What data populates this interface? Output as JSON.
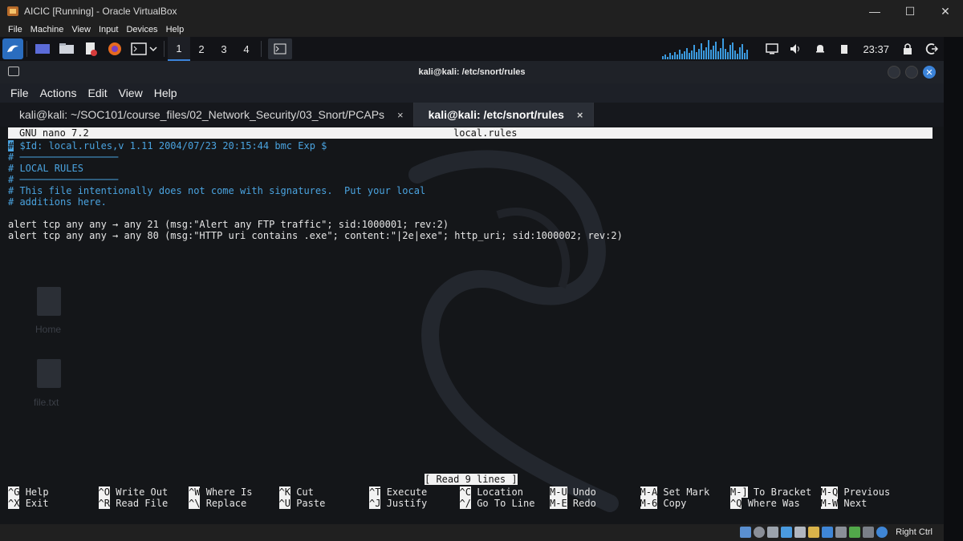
{
  "vbox": {
    "title": "AICIC [Running] - Oracle VirtualBox",
    "menu": [
      "File",
      "Machine",
      "View",
      "Input",
      "Devices",
      "Help"
    ],
    "window_controls": {
      "minimize": "—",
      "maximize": "☐",
      "close": "✕"
    },
    "host_key": "Right Ctrl"
  },
  "panel": {
    "workspaces": [
      "1",
      "2",
      "3",
      "4"
    ],
    "active_workspace": "1",
    "clock": "23:37"
  },
  "terminal": {
    "title": "kali@kali: /etc/snort/rules",
    "menu": [
      "File",
      "Actions",
      "Edit",
      "View",
      "Help"
    ],
    "tabs": [
      {
        "label": "kali@kali: ~/SOC101/course_files/02_Network_Security/03_Snort/PCAPs",
        "close": "×"
      },
      {
        "label": "kali@kali: /etc/snort/rules",
        "close": "×"
      }
    ],
    "close_glyph": "✕"
  },
  "nano": {
    "version": "GNU nano 7.2",
    "filename": "local.rules",
    "cursor_char": "#",
    "lines": [
      " $Id: local.rules,v 1.11 2004/07/23 20:15:44 bmc Exp $",
      "# ─────────────────",
      "# LOCAL RULES",
      "# ─────────────────",
      "# This file intentionally does not come with signatures.  Put your local",
      "# additions here.",
      "",
      "alert tcp any any → any 21 (msg:\"Alert any FTP traffic\"; sid:1000001; rev:2)",
      "alert tcp any any → any 80 (msg:\"HTTP uri contains .exe\"; content:\"|2e|exe\"; http_uri; sid:1000002; rev:2)"
    ],
    "status": "[ Read 9 lines ]",
    "shortcuts": [
      {
        "key": "^G",
        "label": "Help"
      },
      {
        "key": "^O",
        "label": "Write Out"
      },
      {
        "key": "^W",
        "label": "Where Is"
      },
      {
        "key": "^K",
        "label": "Cut"
      },
      {
        "key": "^T",
        "label": "Execute"
      },
      {
        "key": "^C",
        "label": "Location"
      },
      {
        "key": "M-U",
        "label": "Undo"
      },
      {
        "key": "M-A",
        "label": "Set Mark"
      },
      {
        "key": "M-]",
        "label": "To Bracket"
      },
      {
        "key": "M-Q",
        "label": "Previous"
      },
      {
        "key": "^X",
        "label": "Exit"
      },
      {
        "key": "^R",
        "label": "Read File"
      },
      {
        "key": "^\\",
        "label": "Replace"
      },
      {
        "key": "^U",
        "label": "Paste"
      },
      {
        "key": "^J",
        "label": "Justify"
      },
      {
        "key": "^/",
        "label": "Go To Line"
      },
      {
        "key": "M-E",
        "label": "Redo"
      },
      {
        "key": "M-6",
        "label": "Copy"
      },
      {
        "key": "^Q",
        "label": "Where Was"
      },
      {
        "key": "M-W",
        "label": "Next"
      }
    ]
  },
  "desktop_ghost": {
    "home": "Home",
    "file": "file.txt"
  },
  "colors": {
    "comment": "#4aa3df",
    "accent": "#3b83d9",
    "nano_bg": "#141619"
  }
}
